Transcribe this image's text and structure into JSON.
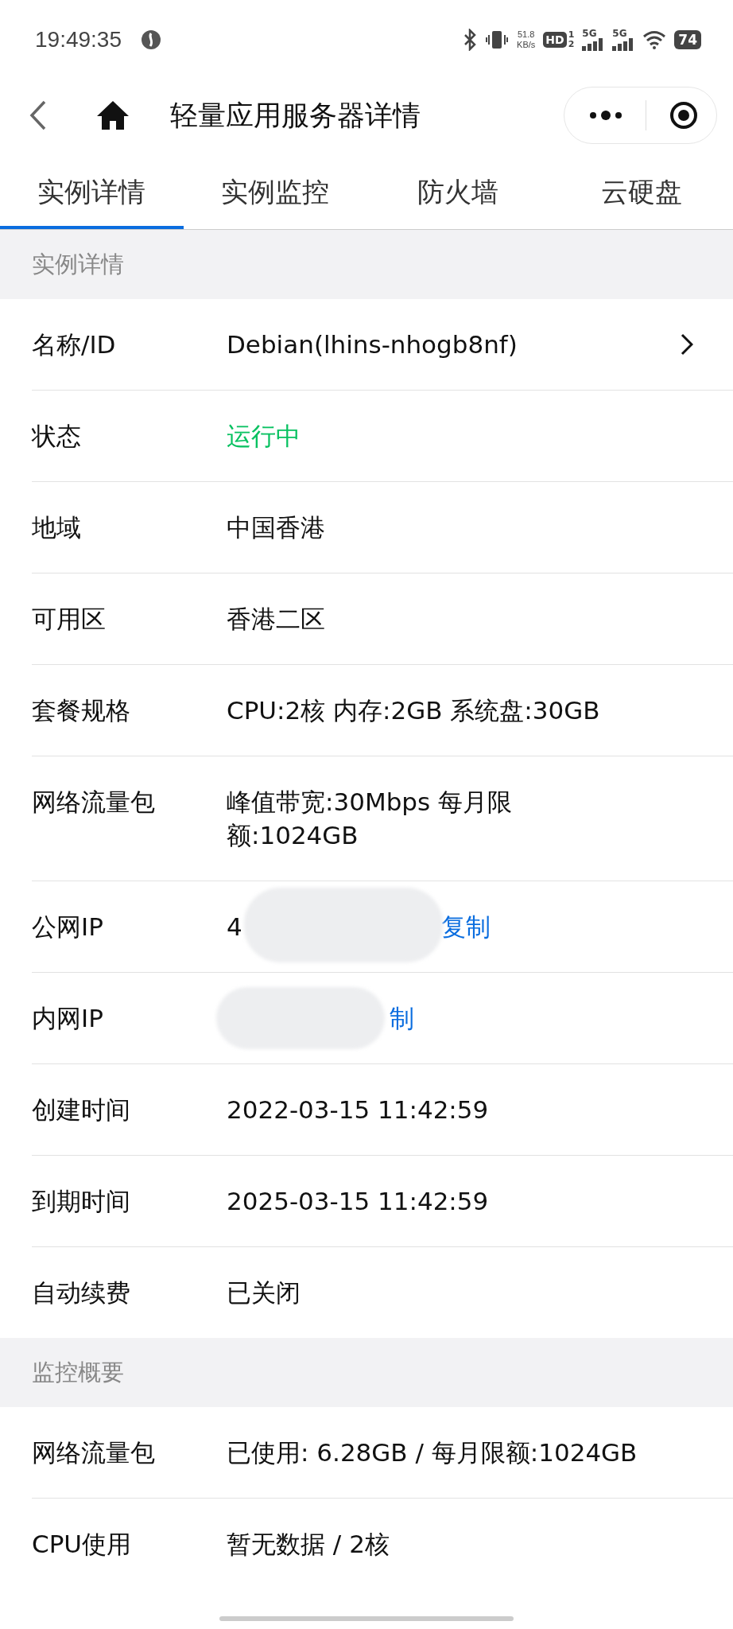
{
  "status_bar": {
    "time": "19:49:35",
    "speed": "51.8",
    "speed_unit": "KB/s",
    "hd": "HD",
    "sim_1": "1",
    "sim_2": "2",
    "net_1": "5G",
    "net_2": "5G",
    "battery": "74"
  },
  "nav": {
    "title": "轻量应用服务器详情"
  },
  "tabs": [
    {
      "label": "实例详情",
      "selected": true
    },
    {
      "label": "实例监控",
      "selected": false
    },
    {
      "label": "防火墙",
      "selected": false
    },
    {
      "label": "云硬盘",
      "selected": false
    }
  ],
  "sections": [
    {
      "title": "实例详情",
      "rows": [
        {
          "label": "名称/ID",
          "value": "Debian(lhins-nhogb8nf)",
          "kind": "text",
          "arrow": true
        },
        {
          "label": "状态",
          "value": "运行中",
          "kind": "status",
          "color": "#07c160"
        },
        {
          "label": "地域",
          "value": "中国香港",
          "kind": "text"
        },
        {
          "label": "可用区",
          "value": "香港二区",
          "kind": "text"
        },
        {
          "label": "套餐规格",
          "value": "CPU:2核 内存:2GB 系统盘:30GB",
          "kind": "text"
        },
        {
          "label": "网络流量包",
          "value": "峰值带宽:30Mbps 每月限额:1024GB",
          "kind": "text"
        },
        {
          "label": "公网IP",
          "value": "4",
          "copy": "复制",
          "kind": "ip"
        },
        {
          "label": "内网IP",
          "copy": "制",
          "kind": "ip"
        },
        {
          "label": "创建时间",
          "value": "2022-03-15 11:42:59",
          "kind": "text"
        },
        {
          "label": "到期时间",
          "value": "2025-03-15 11:42:59",
          "kind": "text"
        },
        {
          "label": "自动续费",
          "value": "已关闭",
          "kind": "text"
        }
      ]
    },
    {
      "title": "监控概要",
      "rows": [
        {
          "label": "网络流量包",
          "value": "已使用: 6.28GB / 每月限额:1024GB",
          "kind": "text"
        },
        {
          "label": "CPU使用",
          "value": "暂无数据 / 2核",
          "kind": "text"
        }
      ]
    }
  ]
}
